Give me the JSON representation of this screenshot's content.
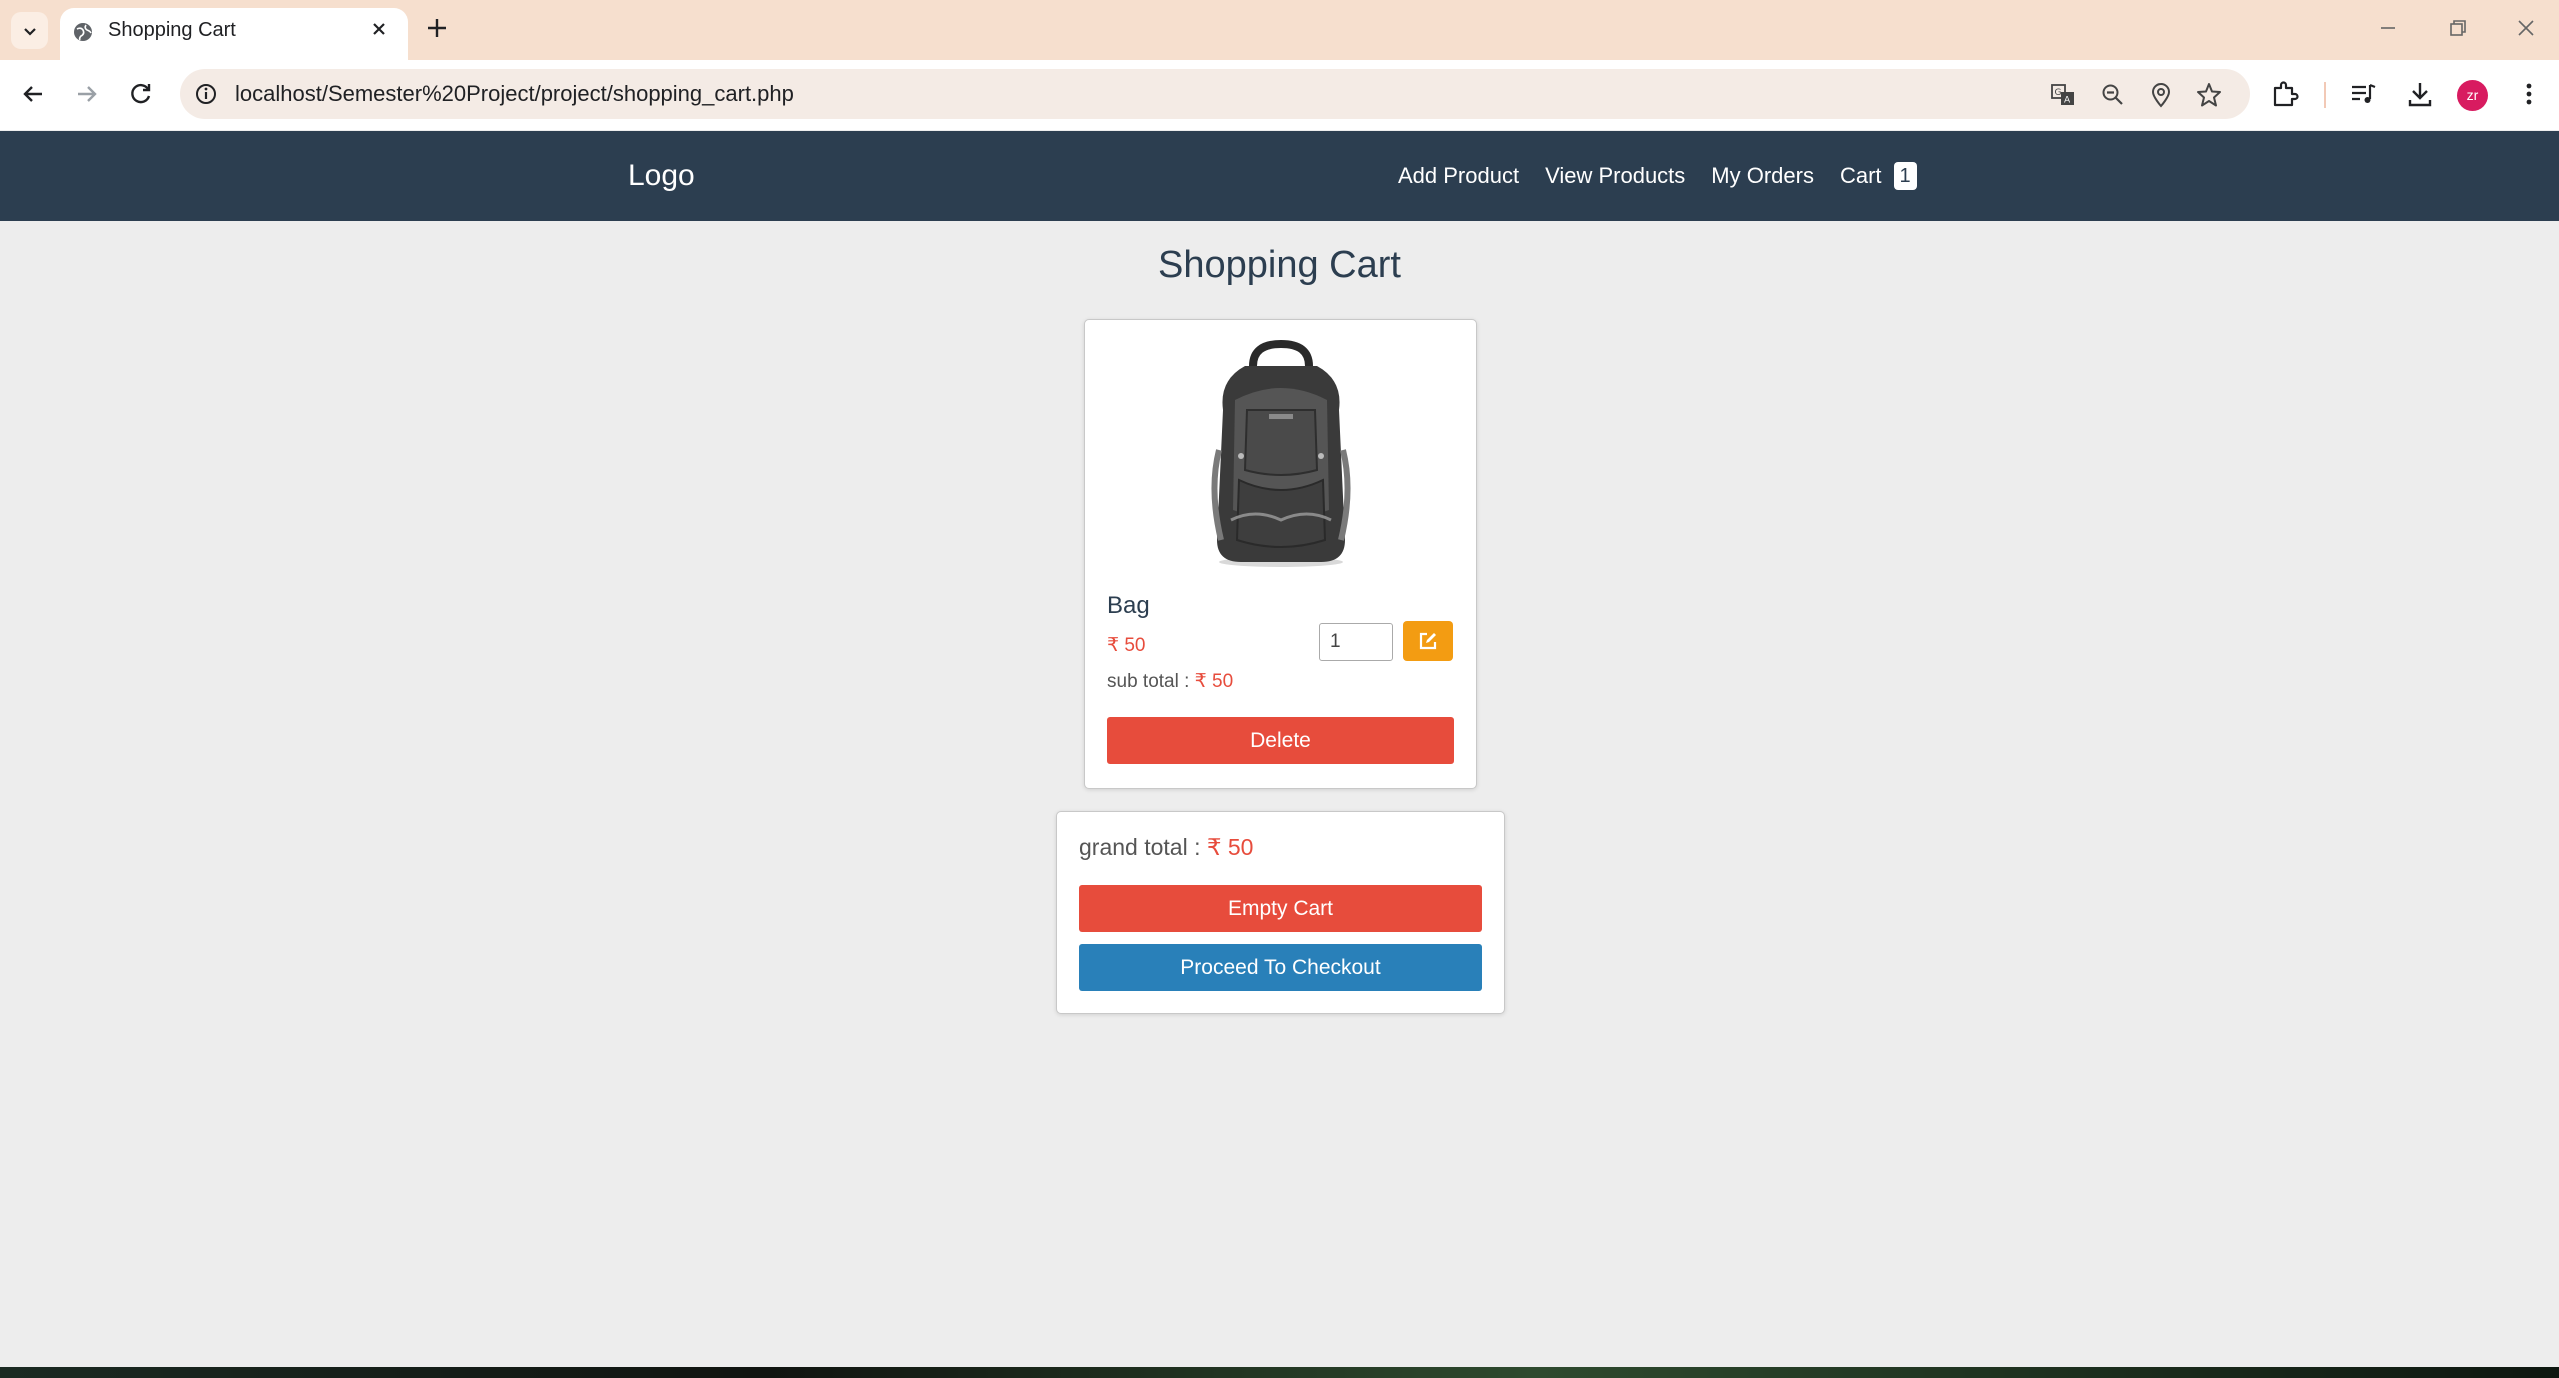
{
  "browser": {
    "tab_title": "Shopping Cart",
    "url": "localhost/Semester%20Project/project/shopping_cart.php",
    "profile_initials": "zr"
  },
  "site": {
    "logo": "Logo",
    "nav": {
      "add_product": "Add Product",
      "view_products": "View Products",
      "my_orders": "My Orders",
      "cart": "Cart",
      "cart_count": "1"
    }
  },
  "page": {
    "title": "Shopping Cart"
  },
  "cart_items": [
    {
      "name": "Bag",
      "price": "₹ 50",
      "subtotal_label": "sub total :",
      "subtotal_value": "₹ 50",
      "quantity": "1",
      "delete_label": "Delete"
    }
  ],
  "summary": {
    "grand_total_label": "grand total :",
    "grand_total_value": "₹ 50",
    "empty_cart_label": "Empty Cart",
    "checkout_label": "Proceed To Checkout"
  },
  "colors": {
    "header_bg": "#2c3e50",
    "danger": "#e74c3c",
    "warning": "#f39c12",
    "primary": "#2980b9",
    "tabbar_bg": "#f6dfce"
  }
}
